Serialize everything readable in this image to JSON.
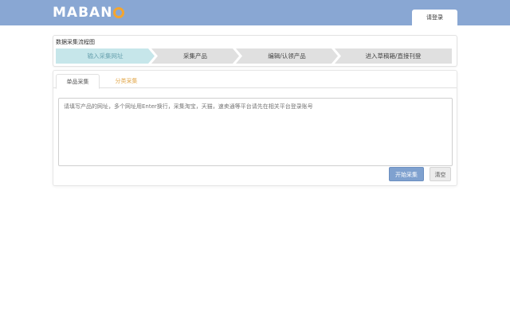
{
  "header": {
    "logo_text": "MABAN",
    "login_label": "请登录",
    "colors": {
      "bar": "#89a7d3",
      "logo_accent": "#f4a52f"
    }
  },
  "flow": {
    "title": "数据采集流程图",
    "steps": [
      {
        "label": "输入采集网址",
        "state": "active"
      },
      {
        "label": "采集产品",
        "state": "inactive"
      },
      {
        "label": "编辑/认领产品",
        "state": "inactive"
      },
      {
        "label": "进入草稿箱/直接刊登",
        "state": "inactive"
      }
    ]
  },
  "tabs": [
    {
      "label": "单品采集",
      "active": true
    },
    {
      "label": "分类采集",
      "active": false
    }
  ],
  "collector": {
    "placeholder": "请填写产品的网址，多个网址用Enter换行，采集淘宝，天猫，速卖通等平台请先在相关平台登录账号",
    "value": "",
    "start_label": "开始采集",
    "clear_label": "清空"
  }
}
